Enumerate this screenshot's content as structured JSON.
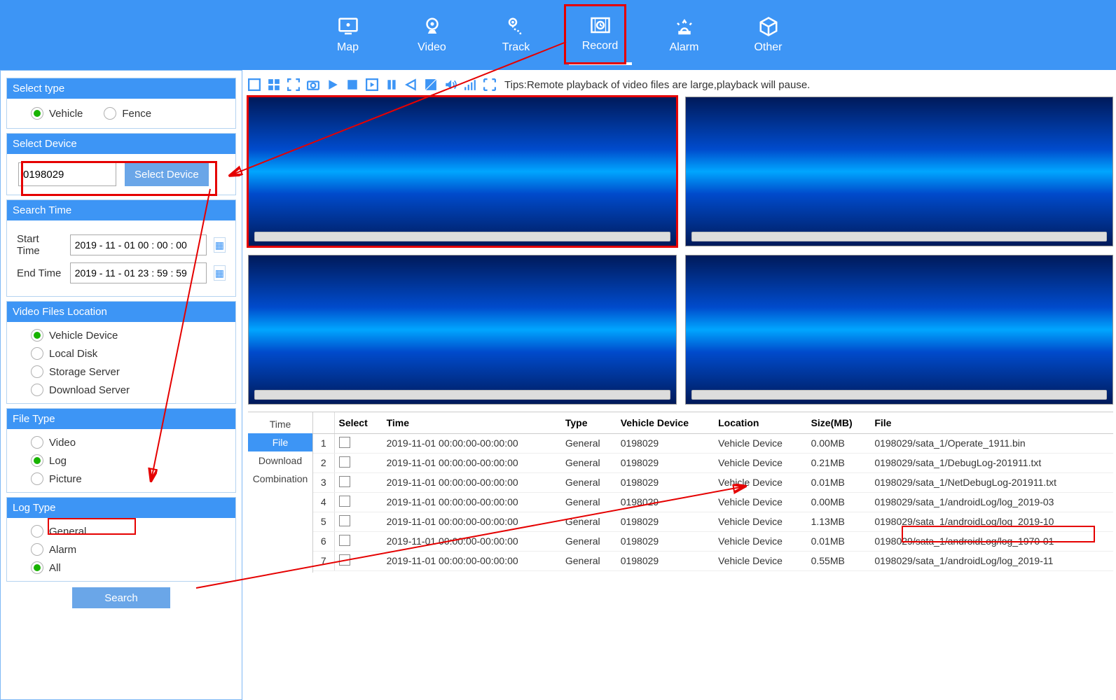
{
  "nav": {
    "items": [
      "Map",
      "Video",
      "Track",
      "Record",
      "Alarm",
      "Other"
    ],
    "active": "Record"
  },
  "tips": "Tips:Remote playback of video files are large,playback will pause.",
  "sidebar": {
    "select_type": {
      "title": "Select type",
      "options": [
        "Vehicle",
        "Fence"
      ],
      "value": "Vehicle"
    },
    "select_device": {
      "title": "Select Device",
      "value": "0198029",
      "button": "Select Device"
    },
    "search_time": {
      "title": "Search Time",
      "start_label": "Start Time",
      "start_value": "2019 - 11 - 01 00 : 00 : 00",
      "end_label": "End Time",
      "end_value": "2019 - 11 - 01 23 : 59 : 59"
    },
    "video_location": {
      "title": "Video Files Location",
      "options": [
        "Vehicle Device",
        "Local Disk",
        "Storage Server",
        "Download Server"
      ],
      "value": "Vehicle Device"
    },
    "file_type": {
      "title": "File Type",
      "options": [
        "Video",
        "Log",
        "Picture"
      ],
      "value": "Log"
    },
    "log_type": {
      "title": "Log Type",
      "options": [
        "General",
        "Alarm",
        "All"
      ],
      "value": "All"
    },
    "search_button": "Search"
  },
  "result_tabs": {
    "items": [
      "Time",
      "File",
      "Download",
      "Combination"
    ],
    "active": "File"
  },
  "table": {
    "headers": [
      "",
      "Select",
      "Time",
      "Type",
      "Vehicle Device",
      "Location",
      "Size(MB)",
      "File"
    ],
    "rows": [
      {
        "n": "1",
        "time": "2019-11-01 00:00:00-00:00:00",
        "type": "General",
        "dev": "0198029",
        "loc": "Vehicle Device",
        "size": "0.00MB",
        "file": "0198029/sata_1/Operate_1911.bin"
      },
      {
        "n": "2",
        "time": "2019-11-01 00:00:00-00:00:00",
        "type": "General",
        "dev": "0198029",
        "loc": "Vehicle Device",
        "size": "0.21MB",
        "file": "0198029/sata_1/DebugLog-201911.txt"
      },
      {
        "n": "3",
        "time": "2019-11-01 00:00:00-00:00:00",
        "type": "General",
        "dev": "0198029",
        "loc": "Vehicle Device",
        "size": "0.01MB",
        "file": "0198029/sata_1/NetDebugLog-201911.txt"
      },
      {
        "n": "4",
        "time": "2019-11-01 00:00:00-00:00:00",
        "type": "General",
        "dev": "0198029",
        "loc": "Vehicle Device",
        "size": "0.00MB",
        "file": "0198029/sata_1/androidLog/log_2019-03"
      },
      {
        "n": "5",
        "time": "2019-11-01 00:00:00-00:00:00",
        "type": "General",
        "dev": "0198029",
        "loc": "Vehicle Device",
        "size": "1.13MB",
        "file": "0198029/sata_1/androidLog/log_2019-10"
      },
      {
        "n": "6",
        "time": "2019-11-01 00:00:00-00:00:00",
        "type": "General",
        "dev": "0198029",
        "loc": "Vehicle Device",
        "size": "0.01MB",
        "file": "0198029/sata_1/androidLog/log_1970-01"
      },
      {
        "n": "7",
        "time": "2019-11-01 00:00:00-00:00:00",
        "type": "General",
        "dev": "0198029",
        "loc": "Vehicle Device",
        "size": "0.55MB",
        "file": "0198029/sata_1/androidLog/log_2019-11"
      }
    ]
  }
}
